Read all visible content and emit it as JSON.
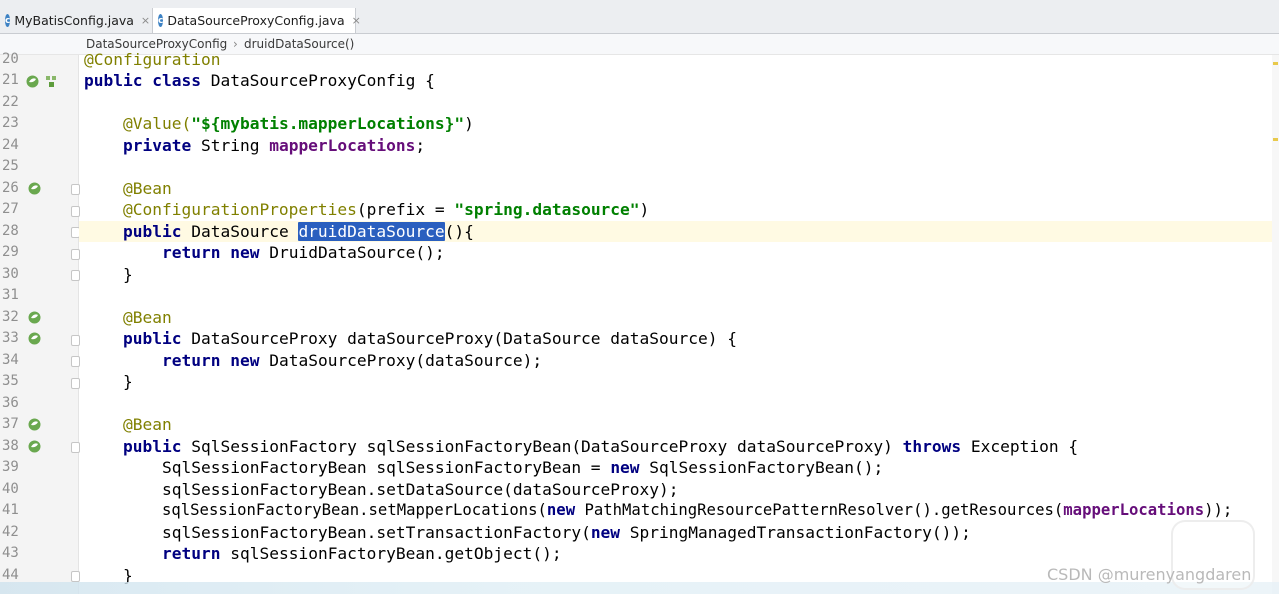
{
  "tabs": [
    {
      "label": "MyBatisConfig.java",
      "icon": "class-icon",
      "active": false
    },
    {
      "label": "DataSourceProxyConfig.java",
      "icon": "class-icon",
      "active": true
    }
  ],
  "tab_close_glyph": "×",
  "class_icon_letter": "c",
  "breadcrumb": {
    "class_name": "DataSourceProxyConfig",
    "separator": "›",
    "method_name": "druidDataSource()"
  },
  "gutter": {
    "line_numbers": [
      "20",
      "21",
      "22",
      "23",
      "24",
      "25",
      "26",
      "27",
      "28",
      "29",
      "30",
      "31",
      "32",
      "33",
      "34",
      "35",
      "36",
      "37",
      "38",
      "39",
      "40",
      "41",
      "42",
      "43",
      "44"
    ]
  },
  "code": {
    "l20": "@Configuration",
    "l21_kw": "public class ",
    "l21_rest": "DataSourceProxyConfig {",
    "l23_ann": "@Value(",
    "l23_str": "\"${mybatis.mapperLocations}\"",
    "l23_end": ")",
    "l24_kw": "private ",
    "l24_type": "String ",
    "l24_fld": "mapperLocations",
    "l24_end": ";",
    "l26": "@Bean",
    "l27_ann": "@ConfigurationProperties",
    "l27_a": "(prefix = ",
    "l27_str": "\"spring.datasource\"",
    "l27_end": ")",
    "l28_kw": "public ",
    "l28_type": "DataSource ",
    "l28_sel": "druidDataSource",
    "l28_end": "(){",
    "l29_kw1": "return ",
    "l29_kw2": "new ",
    "l29_rest": "DruidDataSource();",
    "l30": "}",
    "l32": "@Bean",
    "l33_kw": "public ",
    "l33_rest": "DataSourceProxy dataSourceProxy(DataSource dataSource) {",
    "l34_kw1": "return ",
    "l34_kw2": "new ",
    "l34_rest": "DataSourceProxy(dataSource);",
    "l35": "}",
    "l37": "@Bean",
    "l38_kw": "public ",
    "l38_a": "SqlSessionFactory sqlSessionFactoryBean(DataSourceProxy dataSourceProxy) ",
    "l38_kw2": "throws ",
    "l38_b": "Exception {",
    "l39_a": "SqlSessionFactoryBean sqlSessionFactoryBean = ",
    "l39_kw": "new ",
    "l39_b": "SqlSessionFactoryBean();",
    "l40": "sqlSessionFactoryBean.setDataSource(dataSourceProxy);",
    "l41_a": "sqlSessionFactoryBean.setMapperLocations(",
    "l41_kw": "new ",
    "l41_b": "PathMatchingResourcePatternResolver().getResources(",
    "l41_fld": "mapperLocations",
    "l41_end": "));",
    "l42_a": "sqlSessionFactoryBean.setTransactionFactory(",
    "l42_kw": "new ",
    "l42_b": "SpringManagedTransactionFactory());",
    "l43_kw": "return ",
    "l43_rest": "sqlSessionFactoryBean.getObject();",
    "l44": "}"
  },
  "watermark": "CSDN @murenyangdaren",
  "colors": {
    "keyword": "#000080",
    "annotation": "#808000",
    "string": "#008000",
    "field": "#660e7a",
    "selection": "#2a5fbf",
    "caret_line": "#fffae3"
  }
}
